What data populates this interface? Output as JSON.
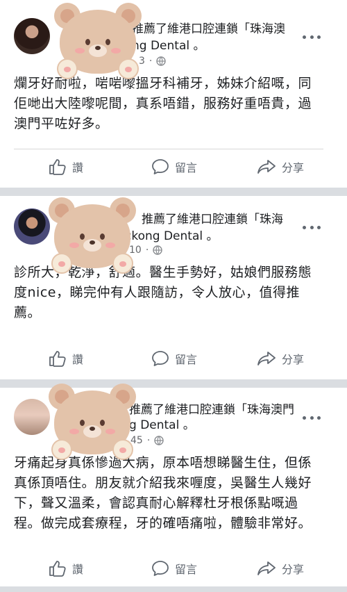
{
  "posts": [
    {
      "header": "推薦了維港口腔連鎖「珠海澳門Hong Kong Dental 」。",
      "header_line1": "推薦了維港口腔連鎖「珠海澳",
      "header_line2": "Hong Kong Dental 」。",
      "meta_time": "3",
      "body_lines": [
        "爛牙好耐啦，啱啱嚟搵牙科補牙，姊妹介紹嘅，同",
        "佢哋出大陸嚟呢間，真系唔錯，服務好重唔貴，過",
        "澳門平咗好多。"
      ]
    },
    {
      "header_line1": "推薦了維港口腔連鎖「珠海",
      "header_line2": "Hong Kong Dental 」。",
      "meta_time": "10",
      "body_lines": [
        "診所大，乾淨，舒適。醫生手勢好，姑娘們服務態",
        "度nice，睇完仲有人跟隨訪，令人放心，值得推",
        "薦。"
      ]
    },
    {
      "header_line1": "推薦了維港口腔連鎖「珠海澳門",
      "header_line2": "Hong Kong Dental 」。",
      "meta_time": "45",
      "body_lines": [
        "牙痛起身真係慘過大病，原本唔想睇醫生住，但係",
        "真係頂唔住。朋友就介紹我來喱度，吳醫生人幾好",
        "下，聲又溫柔，會認真耐心解釋杜牙根係點嘅過",
        "程。做完成套療程，牙的確唔痛啦，體驗非常好。"
      ]
    }
  ],
  "visible": {
    "p1_header_a": "推薦了維港口腔連鎖「珠海澳",
    "p1_header_b": "ng Dental 。",
    "p2_header_a": "推薦了維港口腔連鎖「珠海",
    "p2_header_b": "ckong Dental 。",
    "p3_header_a": "推薦了維港口腔連鎖「珠海澳門",
    "p3_header_b": "g Dental 。"
  },
  "actions": {
    "like": "讚",
    "comment": "留言",
    "share": "分享"
  },
  "colors": {
    "accent": "#1877f2",
    "separator": "#dadde1",
    "muted_text": "#65676b"
  },
  "icons": [
    "like-icon",
    "comment-icon",
    "share-icon",
    "more-icon",
    "globe-icon",
    "bear-sticker"
  ]
}
